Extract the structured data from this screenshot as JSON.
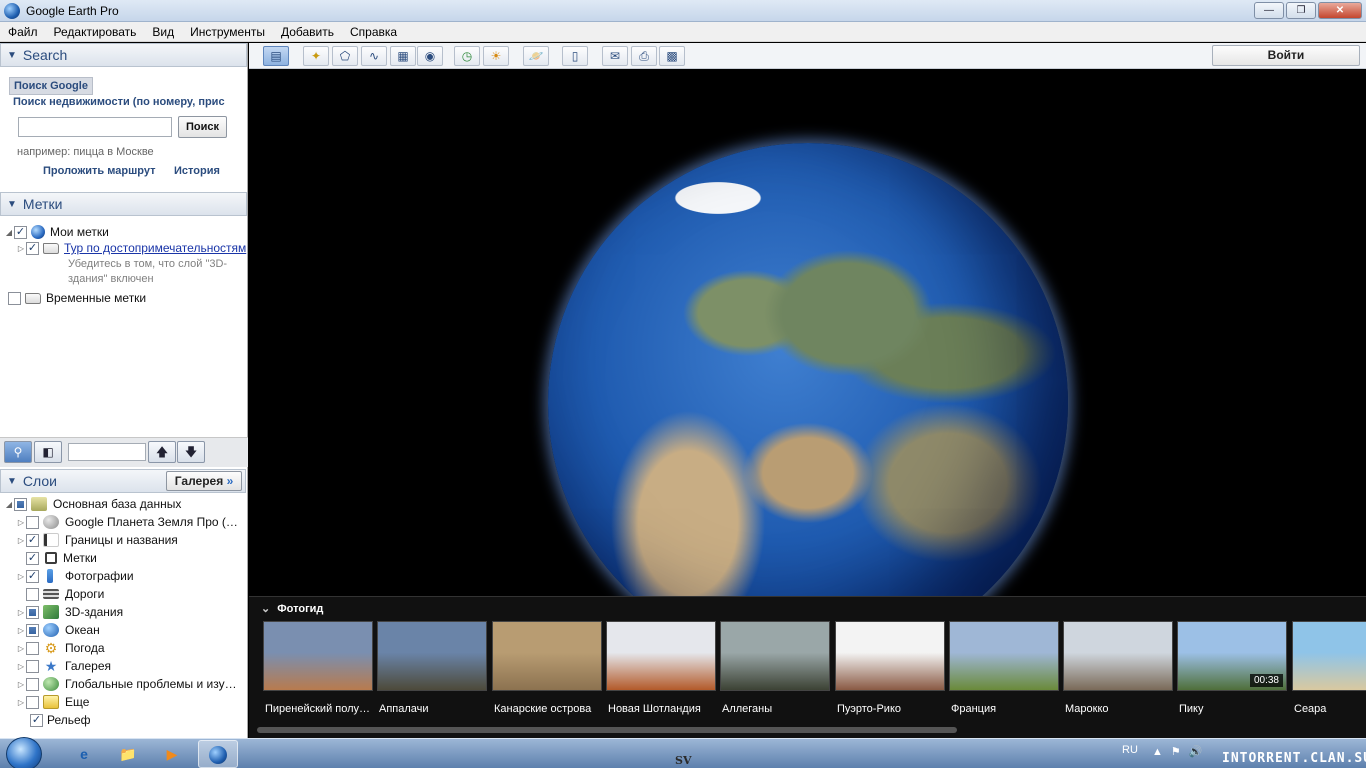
{
  "window": {
    "title": "Google Earth Pro"
  },
  "menu": [
    "Файл",
    "Редактировать",
    "Вид",
    "Инструменты",
    "Добавить",
    "Справка"
  ],
  "search": {
    "header": "Search",
    "tab_google": "Поиск Google",
    "realty_link": "Поиск недвижимости (по номеру, прис",
    "button": "Поиск",
    "example": "например: пицца в Москве",
    "route_link": "Проложить маршрут",
    "history_link": "История"
  },
  "places": {
    "header": "Метки",
    "my_places": "Мои метки",
    "tour": "Тур по достопримечательностям",
    "tour_desc_1": "Убедитесь в том, что слой \"3D-",
    "tour_desc_2": "здания\" включен",
    "temp_places": "Временные метки"
  },
  "layers": {
    "header": "Слои",
    "gallery_button": "Галерея",
    "items": [
      "Основная база данных",
      "Google Планета Земля Про (…",
      "Границы и названия",
      "Метки",
      "Фотографии",
      "Дороги",
      "3D-здания",
      "Океан",
      "Погода",
      "Галерея",
      "Глобальные проблемы и изу…",
      "Еще",
      "Рельеф"
    ]
  },
  "toolbar": {
    "sign_in": "Войти"
  },
  "photo_guide": {
    "title": "Фотогид",
    "items": [
      {
        "label": "Пиренейский полу…",
        "colors": [
          "#7a8fb0",
          "#b87b4e"
        ]
      },
      {
        "label": "Аппалачи",
        "colors": [
          "#6a84a8",
          "#4d4a3a"
        ]
      },
      {
        "label": "Канарские острова",
        "colors": [
          "#b89c72",
          "#8c7250"
        ]
      },
      {
        "label": "Новая Шотландия",
        "colors": [
          "#e5e7ec",
          "#b35a2a"
        ]
      },
      {
        "label": "Аллеганы",
        "colors": [
          "#9aa7a8",
          "#3c4234"
        ]
      },
      {
        "label": "Пуэрто-Рико",
        "colors": [
          "#f3f3f3",
          "#8a5a44"
        ]
      },
      {
        "label": "Франция",
        "colors": [
          "#9fb7d6",
          "#6a8a3a"
        ]
      },
      {
        "label": "Марокко",
        "colors": [
          "#cfd6de",
          "#7a6a58"
        ]
      },
      {
        "label": "Пику",
        "colors": [
          "#9cc0e6",
          "#4f6f3a"
        ]
      },
      {
        "label": "Сеара",
        "colors": [
          "#8fc4e8",
          "#d9c9a0"
        ]
      }
    ],
    "video_duration": "00:38"
  },
  "taskbar": {
    "lang": "RU",
    "watermark": "INTORRENT.CLAN.SU",
    "center_mark": "SV"
  }
}
